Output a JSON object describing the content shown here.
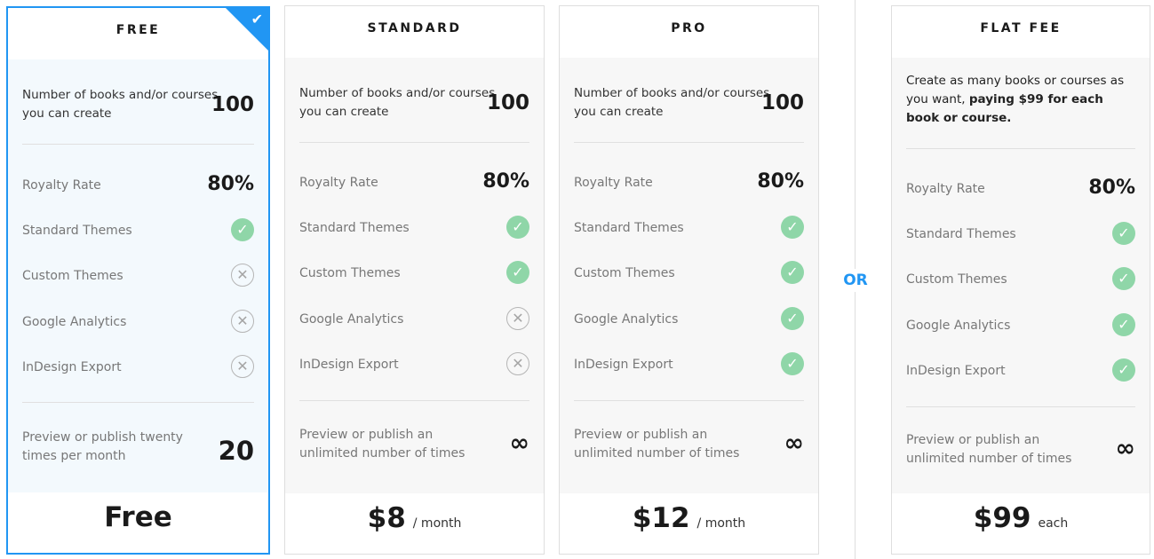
{
  "separator": "OR",
  "plans": [
    {
      "name": "FREE",
      "selected": true,
      "books_label": "Number of books and/or courses you can create",
      "books_value": "100",
      "royalty_label": "Royalty Rate",
      "royalty_value": "80%",
      "features": [
        {
          "label": "Standard Themes",
          "included": true
        },
        {
          "label": "Custom Themes",
          "included": false
        },
        {
          "label": "Google Analytics",
          "included": false
        },
        {
          "label": "InDesign Export",
          "included": false
        }
      ],
      "preview_label": "Preview or publish twenty times per month",
      "preview_value": "20",
      "price": "Free",
      "price_unit": ""
    },
    {
      "name": "STANDARD",
      "selected": false,
      "books_label": "Number of books and/or courses you can create",
      "books_value": "100",
      "royalty_label": "Royalty Rate",
      "royalty_value": "80%",
      "features": [
        {
          "label": "Standard Themes",
          "included": true
        },
        {
          "label": "Custom Themes",
          "included": true
        },
        {
          "label": "Google Analytics",
          "included": false
        },
        {
          "label": "InDesign Export",
          "included": false
        }
      ],
      "preview_label": "Preview or publish an unlimited number of times",
      "preview_value": "∞",
      "price": "$8",
      "price_unit": "/ month"
    },
    {
      "name": "PRO",
      "selected": false,
      "books_label": "Number of books and/or courses you can create",
      "books_value": "100",
      "royalty_label": "Royalty Rate",
      "royalty_value": "80%",
      "features": [
        {
          "label": "Standard Themes",
          "included": true
        },
        {
          "label": "Custom Themes",
          "included": true
        },
        {
          "label": "Google Analytics",
          "included": true
        },
        {
          "label": "InDesign Export",
          "included": true
        }
      ],
      "preview_label": "Preview or publish an unlimited number of times",
      "preview_value": "∞",
      "price": "$12",
      "price_unit": "/ month"
    },
    {
      "name": "FLAT FEE",
      "selected": false,
      "desc_prefix": "Create as many books or courses as you want, ",
      "desc_bold": "paying $99 for each book or course.",
      "royalty_label": "Royalty Rate",
      "royalty_value": "80%",
      "features": [
        {
          "label": "Standard Themes",
          "included": true
        },
        {
          "label": "Custom Themes",
          "included": true
        },
        {
          "label": "Google Analytics",
          "included": true
        },
        {
          "label": "InDesign Export",
          "included": true
        }
      ],
      "preview_label": "Preview or publish an unlimited number of times",
      "preview_value": "∞",
      "price": "$99",
      "price_unit": "each"
    }
  ],
  "icons": {
    "included": "check-circle-icon",
    "excluded": "x-circle-icon",
    "selected": "checkmark-icon"
  },
  "colors": {
    "accent": "#2196f3",
    "included": "#8fd6a8",
    "excluded": "#b5b5b5",
    "body_bg": "#f7f7f7",
    "selected_bg": "#f3f9fd"
  }
}
